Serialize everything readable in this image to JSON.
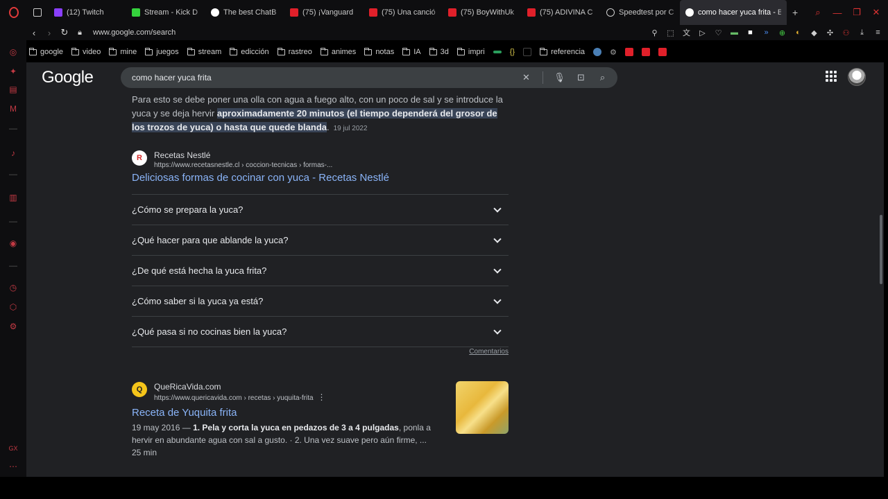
{
  "browser": {
    "tabs": [
      {
        "label": "(12) Twitch",
        "icon": "twitch-icon",
        "kind": "tw"
      },
      {
        "label": "Stream - Kick D",
        "icon": "kick-icon",
        "kind": "kick"
      },
      {
        "label": "The best ChatB",
        "icon": "chatgpt-icon",
        "kind": "gpt"
      },
      {
        "label": "(75) ¡Vanguard",
        "icon": "youtube-icon",
        "kind": "yt"
      },
      {
        "label": "(75) Una canció",
        "icon": "youtube-icon",
        "kind": "yt"
      },
      {
        "label": "(75) BoyWithUk",
        "icon": "youtube-icon",
        "kind": "yt"
      },
      {
        "label": "(75) ADIVINA C",
        "icon": "youtube-icon",
        "kind": "yt"
      },
      {
        "label": "Speedtest por C",
        "icon": "github-icon",
        "kind": "gh"
      },
      {
        "label": "como hacer yuca frita - B",
        "icon": "google-icon",
        "kind": "g",
        "active": true
      }
    ],
    "new_tab": "+",
    "url": "www.google.com/search",
    "bookmarks": [
      {
        "label": "google"
      },
      {
        "label": "video"
      },
      {
        "label": "mine"
      },
      {
        "label": "juegos"
      },
      {
        "label": "stream"
      },
      {
        "label": "edicción"
      },
      {
        "label": "rastreo"
      },
      {
        "label": "animes"
      },
      {
        "label": "notas"
      },
      {
        "label": "IA"
      },
      {
        "label": "3d"
      },
      {
        "label": "impri"
      }
    ],
    "bookmark_after": "referencia"
  },
  "google": {
    "logo": "Google",
    "query": "como hacer yuca frita"
  },
  "featured": {
    "text_before": "Para esto se debe poner una olla con agua a fuego alto, con un poco de sal y se introduce la yuca y se deja hervir ",
    "highlight": "aproximadamente 20 minutos (el tiempo dependerá del grosor de los trozos de yuca) o hasta que quede blanda",
    "text_after": ".",
    "date": "19 jul 2022",
    "source_name": "Recetas Nestlé",
    "source_cite": "https://www.recetasnestle.cl › coccion-tecnicas › formas-...",
    "title": "Deliciosas formas de cocinar con yuca - Recetas Nestlé"
  },
  "faq": {
    "items": [
      "¿Cómo se prepara la yuca?",
      "¿Qué hacer para que ablande la yuca?",
      "¿De qué está hecha la yuca frita?",
      "¿Cómo saber si la yuca ya está?",
      "¿Qué pasa si no cocinas bien la yuca?"
    ],
    "feedback": "Comentarios"
  },
  "result2": {
    "site": "QueRicaVida.com",
    "cite": "https://www.quericavida.com › recetas › yuquita-frita",
    "title": "Receta de Yuquita frita",
    "date": "19 may 2016",
    "bold": "1. Pela y corta la yuca en pedazos de 3 a 4 pulgadas",
    "rest": ", ponla a hervir en abundante agua con sal a gusto. · 2. Una vez suave pero aún firme, ...",
    "time": "25 min"
  }
}
